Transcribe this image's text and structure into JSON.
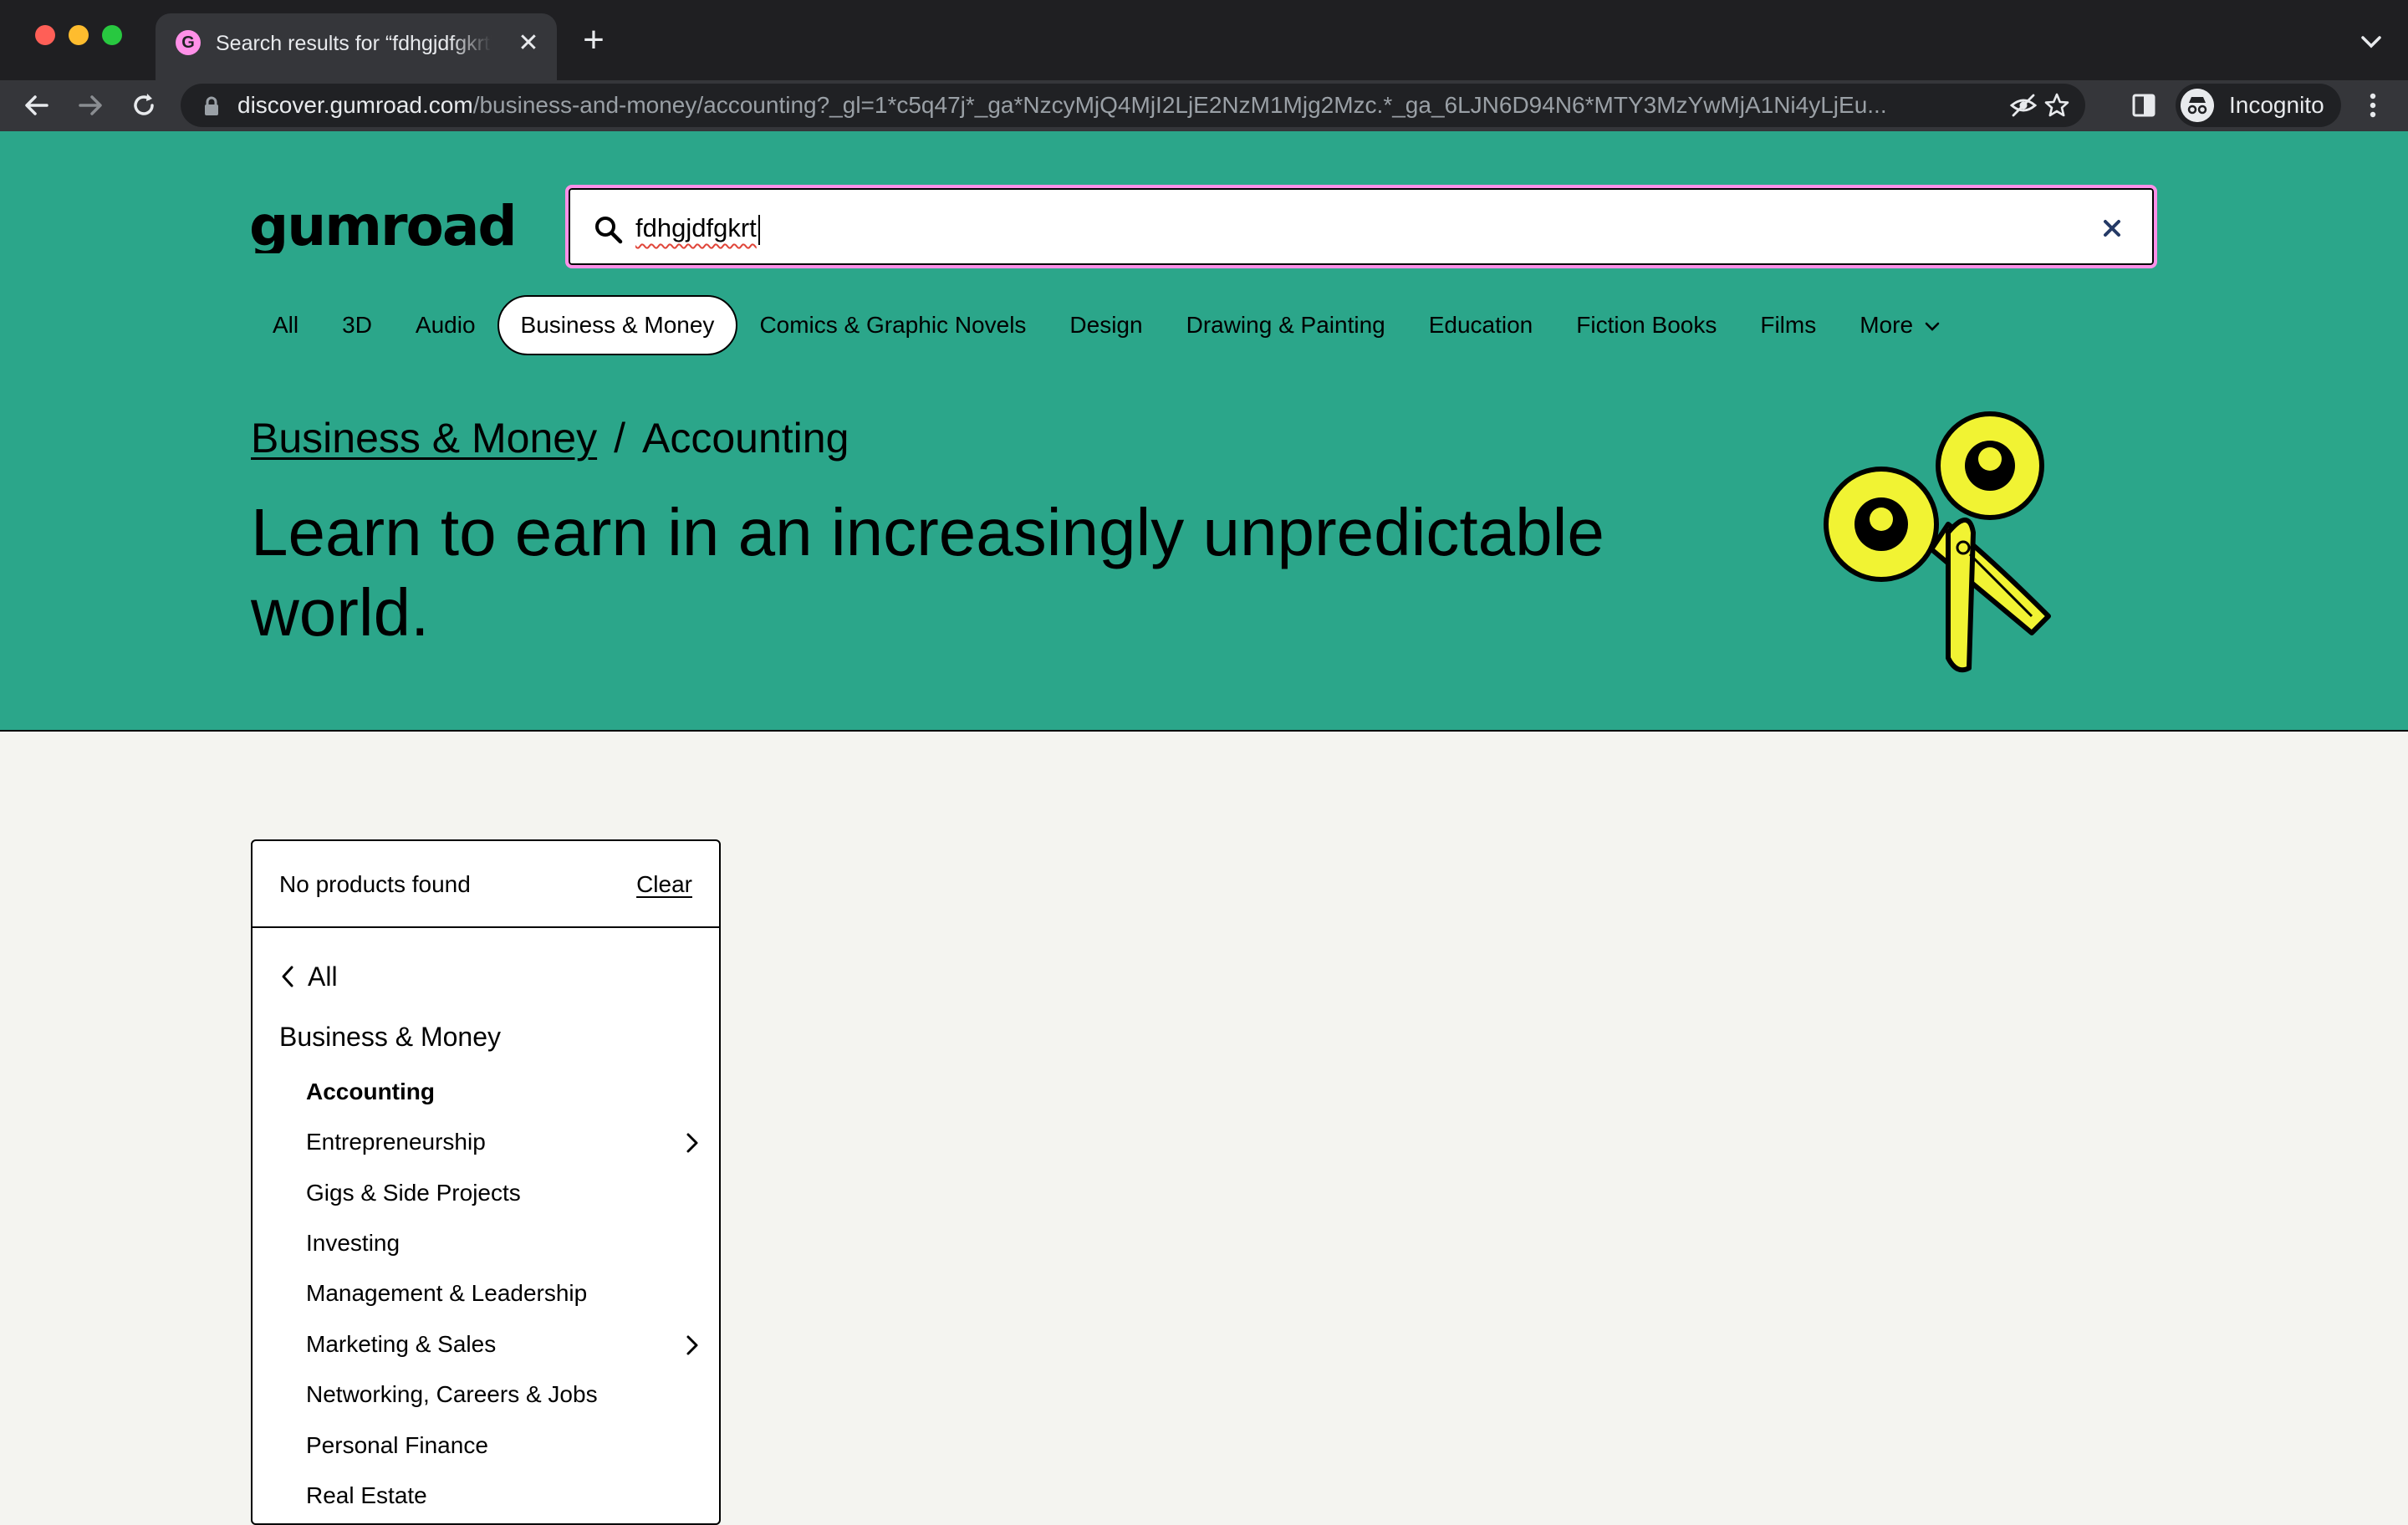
{
  "browser": {
    "tab_title": "Search results for “fdhgjdfgkrt”",
    "tab_favicon_letter": "G",
    "url_host": "discover.gumroad.com",
    "url_path": "/business-and-money/accounting?_gl=1*c5q47j*_ga*NzcyMjQ4MjI2LjE2NzM1Mjg2Mzc.*_ga_6LJN6D94N6*MTY3MzYwMjA1Ni4yLjEu...",
    "profile_label": "Incognito"
  },
  "header": {
    "logo_text": "gumroad",
    "search_value": "fdhgjdfgkrt",
    "categories": [
      "All",
      "3D",
      "Audio",
      "Business & Money",
      "Comics & Graphic Novels",
      "Design",
      "Drawing & Painting",
      "Education",
      "Fiction Books",
      "Films",
      "More"
    ],
    "active_category": "Business & Money"
  },
  "hero": {
    "breadcrumb_parent": "Business & Money",
    "breadcrumb_separator": "/",
    "breadcrumb_current": "Accounting",
    "headline": "Learn to earn in an increasingly unpredictable world."
  },
  "filters": {
    "status": "No products found",
    "clear_label": "Clear",
    "back_label": "All",
    "parent_label": "Business & Money",
    "subcategories": [
      {
        "label": "Accounting",
        "selected": true,
        "has_children": false
      },
      {
        "label": "Entrepreneurship",
        "selected": false,
        "has_children": true
      },
      {
        "label": "Gigs & Side Projects",
        "selected": false,
        "has_children": false
      },
      {
        "label": "Investing",
        "selected": false,
        "has_children": false
      },
      {
        "label": "Management & Leadership",
        "selected": false,
        "has_children": false
      },
      {
        "label": "Marketing & Sales",
        "selected": false,
        "has_children": true
      },
      {
        "label": "Networking, Careers & Jobs",
        "selected": false,
        "has_children": false
      },
      {
        "label": "Personal Finance",
        "selected": false,
        "has_children": false
      },
      {
        "label": "Real Estate",
        "selected": false,
        "has_children": false
      }
    ]
  },
  "colors": {
    "brand_teal": "#2ba68a",
    "accent_pink": "#ff90e8",
    "illustration_yellow": "#f1f333"
  }
}
